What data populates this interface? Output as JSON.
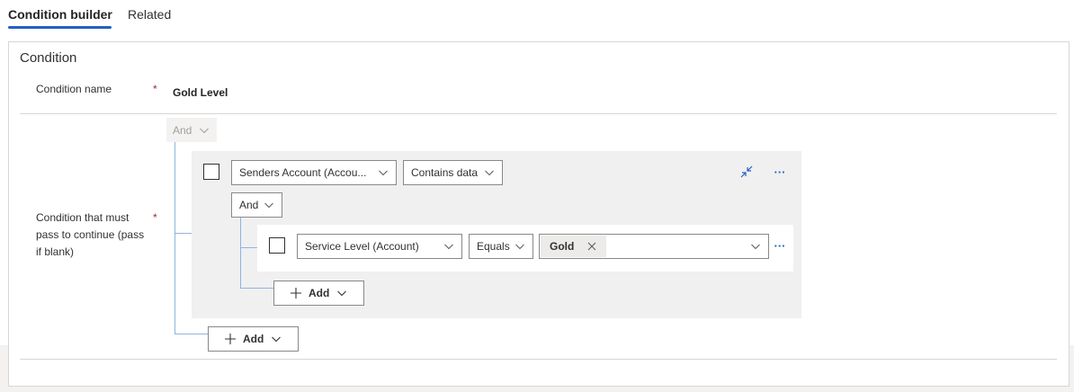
{
  "tabs": [
    {
      "label": "Condition builder",
      "active": true
    },
    {
      "label": "Related",
      "active": false
    }
  ],
  "section": {
    "title": "Condition"
  },
  "condition_name": {
    "label": "Condition name",
    "value": "Gold Level",
    "required_mark": "*"
  },
  "condition_rule": {
    "label": "Condition that must pass to continue (pass if blank)",
    "required_mark": "*"
  },
  "builder": {
    "root_operator": "And",
    "row1": {
      "field": "Senders Account (Accou...",
      "operator": "Contains data"
    },
    "group_operator": "And",
    "row2": {
      "field": "Service Level (Account)",
      "operator": "Equals",
      "value_tag": "Gold"
    },
    "inner_add_label": "Add",
    "outer_add_label": "Add",
    "more_glyph": "···"
  },
  "colors": {
    "accent": "#2460c2",
    "required": "#a4262c",
    "connector": "#8fb3e0",
    "group_bg": "#f0f0f0"
  }
}
